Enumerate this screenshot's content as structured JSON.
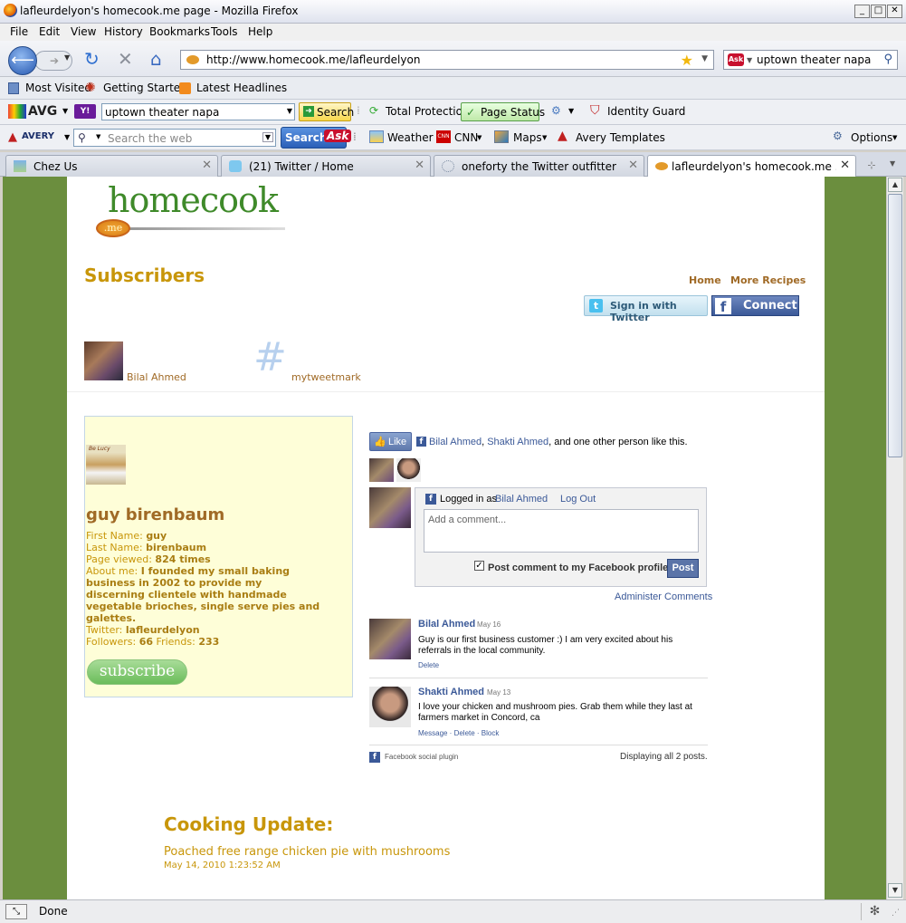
{
  "window": {
    "title": "lafleurdelyon's homecook.me page - Mozilla Firefox",
    "min": "_",
    "max": "□",
    "close": "✕"
  },
  "menu": [
    "File",
    "Edit",
    "View",
    "History",
    "Bookmarks",
    "Tools",
    "Help"
  ],
  "nav": {
    "url": "http://www.homecook.me/lafleurdelyon",
    "search_value": "uptown theater napa",
    "ask_logo": "Ask"
  },
  "bookmarks": [
    "Most Visited",
    "Getting Started",
    "Latest Headlines"
  ],
  "avg_toolbar": {
    "logo": "AVG",
    "search_value": "uptown theater napa",
    "search_button": "Search",
    "total_protection": "Total Protection",
    "page_status": "Page Status",
    "identity_guard": "Identity Guard"
  },
  "ask_toolbar": {
    "logo": "AVERY",
    "search_placeholder": "Search the web",
    "search_button": "Search",
    "ask": "Ask",
    "weather": "Weather",
    "cnn": "CNN",
    "maps": "Maps",
    "avery_templates": "Avery Templates",
    "options": "Options"
  },
  "tabs": [
    {
      "label": "Chez Us",
      "active": false
    },
    {
      "label": "(21) Twitter / Home",
      "active": false
    },
    {
      "label": "oneforty the Twitter outfitter",
      "active": false
    },
    {
      "label": "lafleurdelyon's homecook.me ...",
      "active": true
    }
  ],
  "site": {
    "logo_text": "homecook",
    "logo_badge": ".me",
    "heading": "Subscribers",
    "nav_home": "Home",
    "nav_more": "More Recipes",
    "sign_in_twitter": "Sign in with Twitter",
    "fb_connect": "Connect",
    "subscribers": [
      {
        "name": "Bilal Ahmed"
      },
      {
        "name": "mytweetmark"
      }
    ],
    "hashmark": "#"
  },
  "profile": {
    "photo_caption": "Be Lucy",
    "name": "guy birenbaum",
    "first_name_label": "First Name:",
    "first_name": "guy",
    "last_name_label": "Last Name:",
    "last_name": "birenbaum",
    "viewed_label": "Page viewed:",
    "viewed": "824 times",
    "about_label": "About me:",
    "about_lines": [
      "I founded my small baking",
      "business in 2002 to provide my",
      "discerning clientele with handmade",
      "vegetable brioches, single serve pies and",
      "galettes."
    ],
    "twitter_label": "Twitter:",
    "twitter": "lafleurdelyon",
    "followers_label": "Followers:",
    "followers": "66",
    "friends_label": "Friends:",
    "friends": "233",
    "subscribe": "subscribe"
  },
  "facebook": {
    "like_button": "Like",
    "like_name1": "Bilal Ahmed",
    "like_sep": ",",
    "like_name2": "Shakti Ahmed",
    "like_rest": ", and one other person like this.",
    "logged_in_prefix": "Logged in as",
    "logged_in_user": "Bilal Ahmed",
    "logout": "Log Out",
    "comment_placeholder": "Add a comment...",
    "post_checkbox_label": "Post comment to my Facebook profile",
    "post_button": "Post",
    "admin": "Administer Comments",
    "comments": [
      {
        "author": "Bilal Ahmed",
        "date": "May 16",
        "text1": "Guy is our first business customer :) I am very excited about his",
        "text2": "referrals in the local community.",
        "actions": "Delete"
      },
      {
        "author": "Shakti Ahmed",
        "date": "May 13",
        "text1": "I love your chicken and mushroom pies. Grab them while they last at",
        "text2": "farmers market in Concord, ca",
        "actions": "Message · Delete · Block"
      }
    ],
    "plugin": "Facebook social plugin",
    "displaying": "Displaying all 2 posts."
  },
  "update": {
    "heading": "Cooking Update:",
    "title": "Poached free range chicken pie with mushrooms",
    "date": "May 14, 2010 1:23:52 AM"
  },
  "status": {
    "text": "Done"
  },
  "colors": {
    "page_bg": "#6b8e3e",
    "olive": "#c8960a",
    "brown": "#a06a26",
    "fb_blue": "#3b5998"
  }
}
